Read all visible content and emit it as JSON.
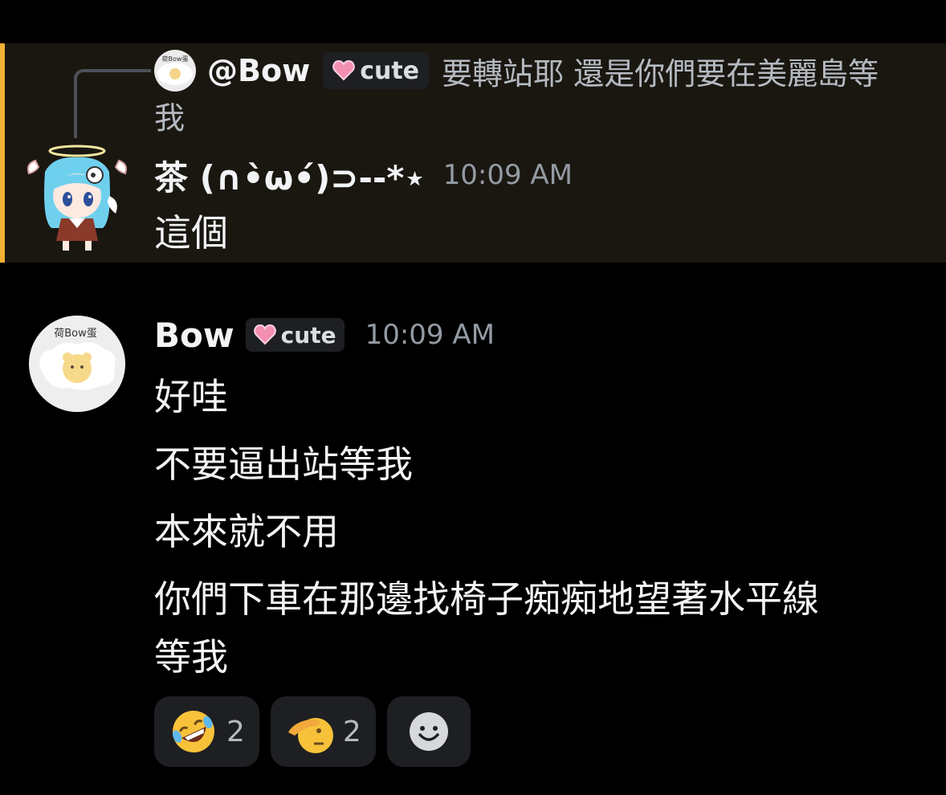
{
  "colors": {
    "background": "#000000",
    "mention_highlight": "#1a1711",
    "mention_bar": "#f0b232",
    "tag_bg": "#1e1f22",
    "heart": "#f48fb1"
  },
  "reply": {
    "author": "@Bow",
    "tag": "cute",
    "excerpt_line1": "要轉站耶 還是你們要在美麗島等",
    "excerpt_line2": "我",
    "avatar_text": "荷Bow蛋"
  },
  "message1": {
    "author": "茶 (∩•̀ω•́)⊃--*⋆",
    "timestamp": "10:09 AM",
    "content": "這個",
    "avatar_icon": "anime-girl-avatar"
  },
  "message2": {
    "author": "Bow",
    "tag": "cute",
    "timestamp": "10:09 AM",
    "avatar_text": "荷Bow蛋",
    "lines": [
      "好哇",
      "不要逼出站等我",
      "本來就不用",
      "你們下車在那邊找椅子痴痴地望著水平線",
      "等我"
    ]
  },
  "reactions": [
    {
      "icon": "rolling-on-floor-laughing-icon",
      "count": "2"
    },
    {
      "icon": "saluting-face-icon",
      "count": "2"
    },
    {
      "icon": "add-reaction-icon",
      "count": ""
    }
  ]
}
